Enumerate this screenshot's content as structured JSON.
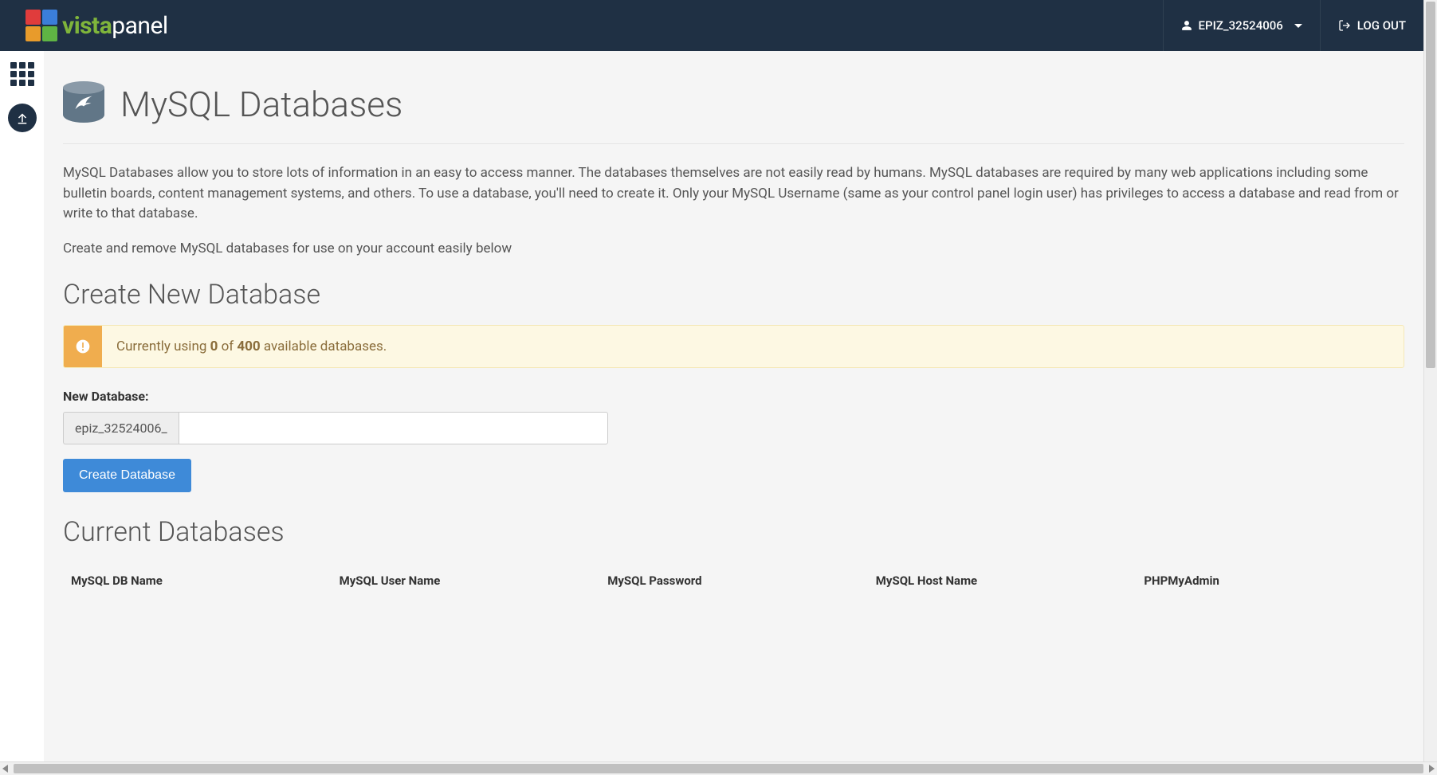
{
  "header": {
    "brand_vista": "vista",
    "brand_panel": "panel",
    "username": "EPIZ_32524006",
    "logout": "LOG OUT"
  },
  "page": {
    "title": "MySQL Databases",
    "description": "MySQL Databases allow you to store lots of information in an easy to access manner. The databases themselves are not easily read by humans. MySQL databases are required by many web applications including some bulletin boards, content management systems, and others. To use a database, you'll need to create it. Only your MySQL Username (same as your control panel login user) has privileges to access a database and read from or write to that database.",
    "sub_description": "Create and remove MySQL databases for use on your account easily below"
  },
  "create": {
    "heading": "Create New Database",
    "alert_prefix": "Currently using ",
    "alert_used": "0",
    "alert_of": " of ",
    "alert_total": "400",
    "alert_suffix": " available databases.",
    "form_label": "New Database:",
    "prefix": "epiz_32524006_",
    "button": "Create Database"
  },
  "current": {
    "heading": "Current Databases",
    "columns": {
      "db_name": "MySQL DB Name",
      "user_name": "MySQL User Name",
      "password": "MySQL Password",
      "host_name": "MySQL Host Name",
      "phpmyadmin": "PHPMyAdmin"
    }
  }
}
